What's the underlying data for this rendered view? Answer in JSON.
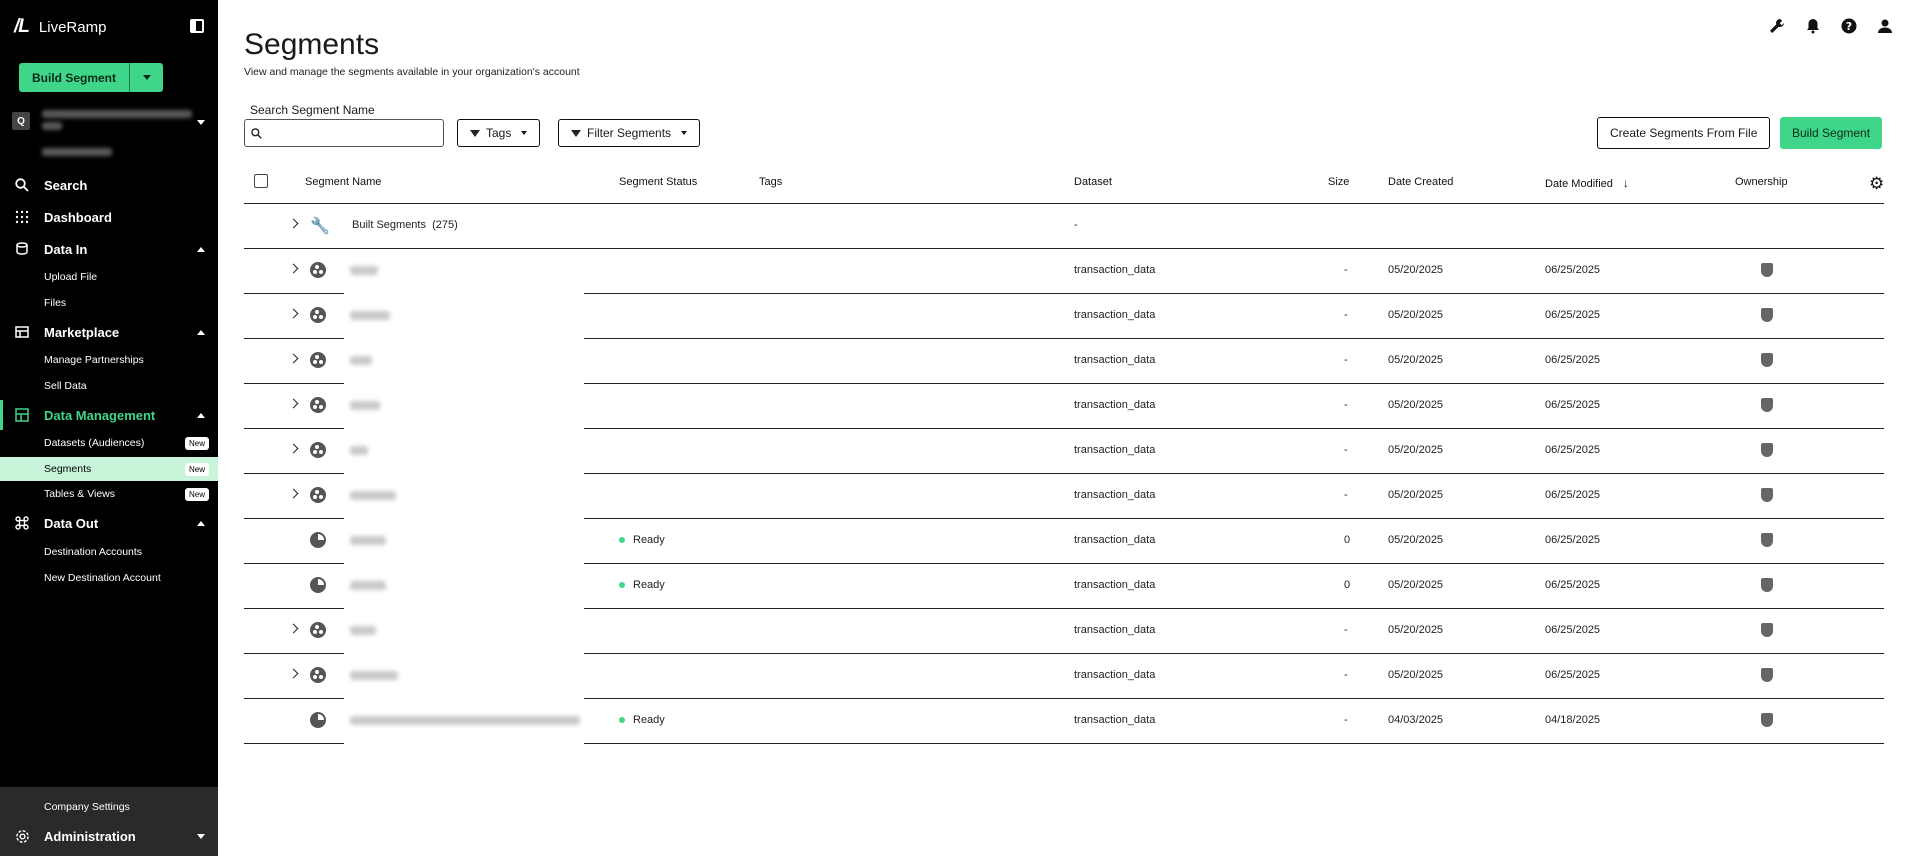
{
  "brand": {
    "logo_mark": "/L",
    "name": "LiveRamp"
  },
  "sidebar": {
    "build_button": "Build Segment",
    "account_badge": "Q",
    "nav": [
      {
        "label": "Search",
        "icon": "search-icon"
      },
      {
        "label": "Dashboard",
        "icon": "dashboard-icon"
      },
      {
        "label": "Data In",
        "icon": "data-in-icon",
        "children": [
          "Upload File",
          "Files"
        ]
      },
      {
        "label": "Marketplace",
        "icon": "marketplace-icon",
        "children": [
          "Manage Partnerships",
          "Sell Data"
        ]
      },
      {
        "label": "Data Management",
        "icon": "data-management-icon",
        "active": true,
        "children": [
          "Datasets (Audiences)",
          "Segments",
          "Tables & Views"
        ]
      },
      {
        "label": "Data Out",
        "icon": "data-out-icon",
        "children": [
          "Destination Accounts",
          "New Destination Account"
        ]
      }
    ],
    "new_badge": "New",
    "company_settings": "Company Settings",
    "administration": "Administration"
  },
  "page": {
    "title": "Segments",
    "subtitle": "View and manage the segments available in your organization's account",
    "search_label": "Search Segment Name",
    "search_placeholder": "",
    "tags_button": "Tags",
    "filter_button": "Filter Segments",
    "create_from_file_button": "Create Segments From File",
    "build_segment_button": "Build Segment"
  },
  "table": {
    "columns": {
      "name": "Segment Name",
      "status": "Segment Status",
      "tags": "Tags",
      "dataset": "Dataset",
      "size": "Size",
      "created": "Date Created",
      "modified": "Date Modified",
      "ownership": "Ownership"
    },
    "group_row": {
      "label": "Built Segments",
      "count": "(275)",
      "dataset": "-"
    },
    "rows": [
      {
        "expandable": true,
        "status": "",
        "dataset": "transaction_data",
        "size": "-",
        "created": "05/20/2025",
        "modified": "06/25/2025"
      },
      {
        "expandable": true,
        "status": "",
        "dataset": "transaction_data",
        "size": "-",
        "created": "05/20/2025",
        "modified": "06/25/2025"
      },
      {
        "expandable": true,
        "status": "",
        "dataset": "transaction_data",
        "size": "-",
        "created": "05/20/2025",
        "modified": "06/25/2025"
      },
      {
        "expandable": true,
        "status": "",
        "dataset": "transaction_data",
        "size": "-",
        "created": "05/20/2025",
        "modified": "06/25/2025"
      },
      {
        "expandable": true,
        "status": "",
        "dataset": "transaction_data",
        "size": "-",
        "created": "05/20/2025",
        "modified": "06/25/2025"
      },
      {
        "expandable": true,
        "status": "",
        "dataset": "transaction_data",
        "size": "-",
        "created": "05/20/2025",
        "modified": "06/25/2025"
      },
      {
        "expandable": false,
        "status": "Ready",
        "dataset": "transaction_data",
        "size": "0",
        "created": "05/20/2025",
        "modified": "06/25/2025"
      },
      {
        "expandable": false,
        "status": "Ready",
        "dataset": "transaction_data",
        "size": "0",
        "created": "05/20/2025",
        "modified": "06/25/2025"
      },
      {
        "expandable": true,
        "status": "",
        "dataset": "transaction_data",
        "size": "-",
        "created": "05/20/2025",
        "modified": "06/25/2025"
      },
      {
        "expandable": true,
        "status": "",
        "dataset": "transaction_data",
        "size": "-",
        "created": "05/20/2025",
        "modified": "06/25/2025"
      },
      {
        "expandable": false,
        "status": "Ready",
        "dataset": "transaction_data",
        "size": "-",
        "created": "04/03/2025",
        "modified": "04/18/2025"
      }
    ]
  },
  "colors": {
    "accent": "#3fd68a",
    "sidebar_bg": "#000000",
    "selected_bg": "#c8f5da"
  }
}
